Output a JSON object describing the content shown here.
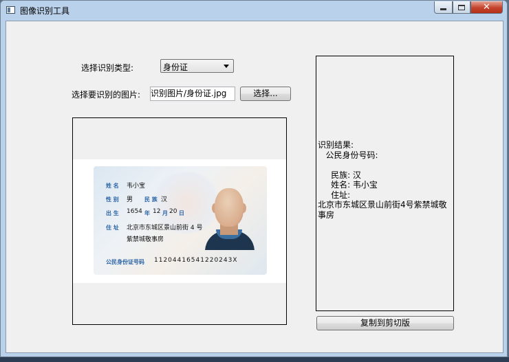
{
  "window": {
    "title": "图像识别工具",
    "close_glyph": "✕"
  },
  "form": {
    "type_label": "选择识别类型:",
    "type_selected": "身份证",
    "image_label": "选择要识别的图片:",
    "image_path": "识别图片/身份证.jpg",
    "choose_button": "选择...",
    "copy_button": "复制到剪切版"
  },
  "id_card": {
    "name_label": "姓 名",
    "name_value": "韦小宝",
    "sex_label": "性 别",
    "sex_value": "男",
    "ethnic_label": "民 族",
    "ethnic_value": "汉",
    "birth_label": "出 生",
    "birth_year": "1654",
    "year_char": "年",
    "birth_month": "12",
    "month_char": "月",
    "birth_day": "20",
    "day_char": "日",
    "address_label": "住 址",
    "address_line1": "北京市东城区景山前街 4 号",
    "address_line2": "紫禁城敬事房",
    "id_label": "公民身份证号码",
    "id_value": "11204416541220243X"
  },
  "result": {
    "text": "识别结果:\n   公民身份号码:\n\n     民族: 汉\n     姓名: 韦小宝\n     住址:\n北京市东城区景山前街4号紫禁城敬事房"
  },
  "colors": {
    "titlebar": "#b9d1ea",
    "client": "#f0f0f0",
    "card_field": "#2b64a6"
  }
}
